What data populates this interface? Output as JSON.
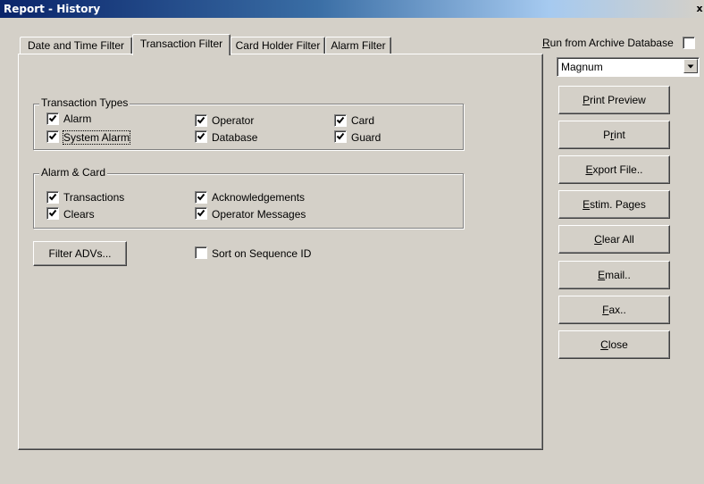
{
  "window": {
    "title": "Report  - History",
    "close_glyph": "x"
  },
  "tabs": [
    {
      "label": "Date and Time Filter",
      "active": false
    },
    {
      "label": "Transaction Filter",
      "active": true
    },
    {
      "label": "Card Holder Filter",
      "active": false
    },
    {
      "label": "Alarm Filter",
      "active": false
    }
  ],
  "transaction_types": {
    "legend": "Transaction Types",
    "items": [
      {
        "label": "Alarm",
        "checked": true
      },
      {
        "label": "System Alarm",
        "checked": true
      },
      {
        "label": "Operator",
        "checked": true
      },
      {
        "label": "Database",
        "checked": true
      },
      {
        "label": "Card",
        "checked": true
      },
      {
        "label": "Guard",
        "checked": true
      }
    ]
  },
  "alarm_card": {
    "legend": "Alarm & Card",
    "items": [
      {
        "label": "Transactions",
        "checked": true
      },
      {
        "label": "Clears",
        "checked": true
      },
      {
        "label": "Acknowledgements",
        "checked": true
      },
      {
        "label": "Operator Messages",
        "checked": true
      }
    ]
  },
  "filter_advs_button": "Filter ADVs...",
  "sort_sequence": {
    "label": "Sort on Sequence ID",
    "checked": false
  },
  "archive": {
    "mnemonic": "R",
    "rest": "un from Archive Database",
    "checked": false
  },
  "database_select": {
    "value": "Magnum"
  },
  "side_buttons": [
    {
      "pre": "",
      "mnemonic": "P",
      "post": "rint Preview"
    },
    {
      "pre": "P",
      "mnemonic": "r",
      "post": "int"
    },
    {
      "pre": "",
      "mnemonic": "E",
      "post": "xport File.."
    },
    {
      "pre": "",
      "mnemonic": "E",
      "post": "stim. Pages"
    },
    {
      "pre": "",
      "mnemonic": "C",
      "post": "lear All"
    },
    {
      "pre": "",
      "mnemonic": "E",
      "post": "mail.."
    },
    {
      "pre": "",
      "mnemonic": "F",
      "post": "ax.."
    },
    {
      "pre": "",
      "mnemonic": "C",
      "post": "lose"
    }
  ]
}
